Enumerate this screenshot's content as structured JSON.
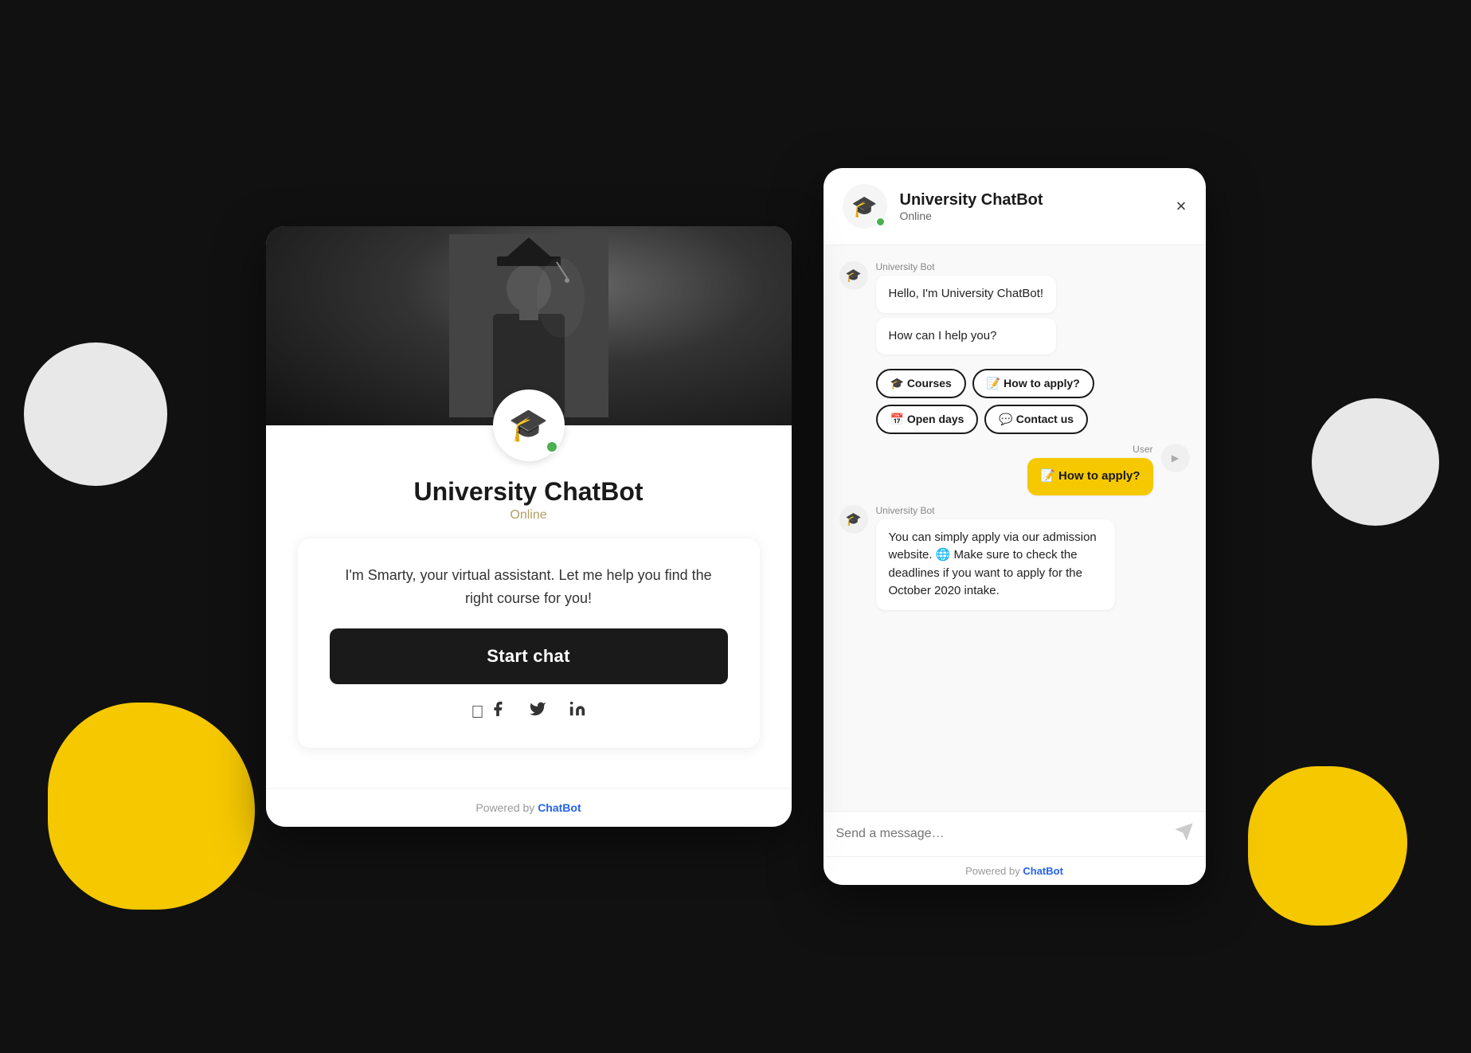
{
  "left_panel": {
    "bot_name": "University ChatBot",
    "bot_status": "Online",
    "welcome_text": "I'm Smarty, your virtual assistant. Let me help you find the right course for you!",
    "start_chat_label": "Start chat",
    "powered_label": "Powered by ",
    "powered_link": "ChatBot",
    "social": [
      "facebook-icon",
      "twitter-icon",
      "linkedin-icon"
    ]
  },
  "right_panel": {
    "header": {
      "bot_name": "University ChatBot",
      "bot_status": "Online",
      "close_label": "×"
    },
    "messages": [
      {
        "sender": "bot",
        "sender_label": "University Bot",
        "bubbles": [
          "Hello, I'm University ChatBot!",
          "How can I help you?"
        ]
      }
    ],
    "quick_replies": [
      {
        "label": "🎓 Courses"
      },
      {
        "label": "📝 How to apply?"
      },
      {
        "label": "📅 Open days"
      },
      {
        "label": "💬 Contact us"
      }
    ],
    "user_message": {
      "sender_label": "User",
      "bubble": "📝 How to apply?"
    },
    "bot_reply": {
      "sender_label": "University Bot",
      "bubble": "You can simply apply via our admission website. 🌐 Make sure to check the deadlines if you want to apply for the October 2020 intake."
    },
    "input_placeholder": "Send a message…",
    "powered_label": "Powered by ",
    "powered_link": "ChatBot"
  }
}
